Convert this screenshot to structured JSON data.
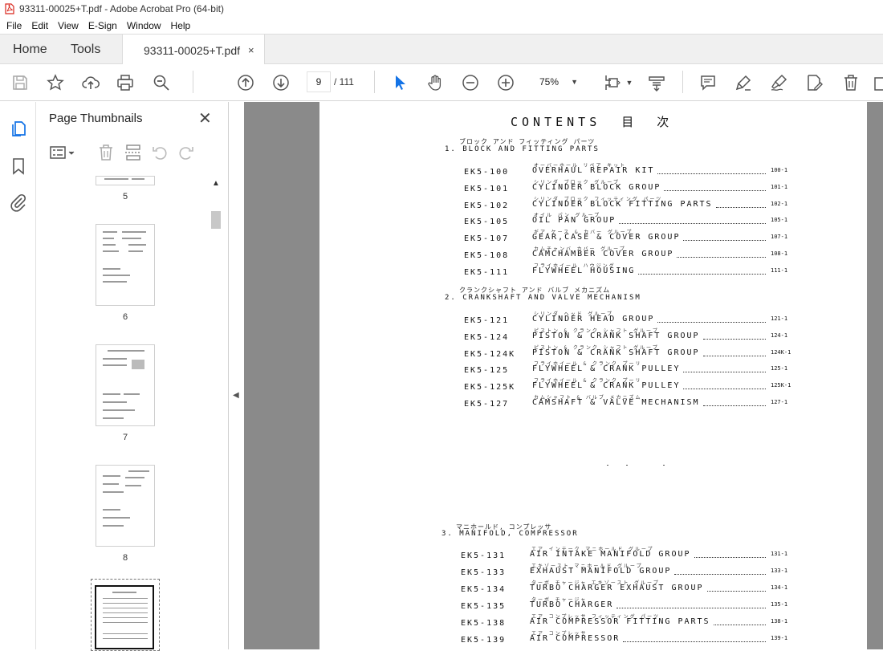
{
  "window": {
    "title": "93311-00025+T.pdf - Adobe Acrobat Pro (64-bit)"
  },
  "menu": [
    "File",
    "Edit",
    "View",
    "E-Sign",
    "Window",
    "Help"
  ],
  "tabs": {
    "home": "Home",
    "tools": "Tools",
    "document": "93311-00025+T.pdf",
    "close_glyph": "×"
  },
  "toolbar": {
    "current_page": "9",
    "total_pages": "/  111",
    "zoom": "75%",
    "icons": [
      "save-icon",
      "star-icon",
      "upload-icon",
      "print-icon",
      "zoom-search-icon",
      "prev-page-icon",
      "next-page-icon",
      "select-cursor-icon",
      "hand-icon",
      "zoom-out-icon",
      "zoom-in-icon",
      "fit-page-icon",
      "scroll-mode-icon",
      "comment-icon",
      "highlight-icon",
      "sign-icon",
      "edit-pdf-icon",
      "delete-icon",
      "more-icon"
    ],
    "accent": "#1473e6"
  },
  "thumbnails": {
    "header": "Page Thumbnails",
    "close_glyph": "✕",
    "page_numbers": [
      "5",
      "6",
      "7",
      "8"
    ]
  },
  "document": {
    "title": "CONTENTS",
    "title_jp": "目 次",
    "sections": [
      {
        "kana": "ブロック  アンド  フィッティング  パーツ",
        "heading": "1. BLOCK  AND  FITTING  PARTS",
        "entries": [
          {
            "code": "EK5-100",
            "kana": "オーバーホール  リペア  キット",
            "name": "OVERHAUL  REPAIR  KIT",
            "page": "100-1"
          },
          {
            "code": "EK5-101",
            "kana": "シリンダ  ブロック  グループ",
            "name": "CYLINDER  BLOCK  GROUP",
            "page": "101-1"
          },
          {
            "code": "EK5-102",
            "kana": "シリンダ  ブロック  フィッティング  パーツ",
            "name": "CYLINDER  BLOCK  FITTING  PARTS",
            "page": "102-1"
          },
          {
            "code": "EK5-105",
            "kana": "オイル  パン  グループ",
            "name": "OIL  PAN  GROUP",
            "page": "105-1"
          },
          {
            "code": "EK5-107",
            "kana": "ギア,ケース  &  カバー  グループ",
            "name": "GEAR,CASE  &  COVER  GROUP",
            "page": "107-1"
          },
          {
            "code": "EK5-108",
            "kana": "カムチャンバ  カバー  グループ",
            "name": "CAMCHAMBER  COVER  GROUP",
            "page": "108-1"
          },
          {
            "code": "EK5-111",
            "kana": "フライホイール  ハウジング",
            "name": "FLYWHEEL  HOUSING",
            "page": "111-1"
          }
        ]
      },
      {
        "kana": "クランクシャフト  アンド  バルブ  メカニズム",
        "heading": "2. CRANKSHAFT  AND  VALVE  MECHANISM",
        "entries": [
          {
            "code": "EK5-121",
            "kana": "シリンダ  ヘッド  グループ",
            "name": "CYLINDER  HEAD  GROUP",
            "page": "121-1"
          },
          {
            "code": "EK5-124",
            "kana": "ピストン  &  クランク  シャフト  グループ",
            "name": "PISTON  &  CRANK  SHAFT  GROUP",
            "page": "124-1"
          },
          {
            "code": "EK5-124K",
            "kana": "ピストン  &  クランク  シャフト  グループ",
            "name": "PISTON  &  CRANK  SHAFT  GROUP",
            "page": "124K-1"
          },
          {
            "code": "EK5-125",
            "kana": "フライホイール  &  クランク  プーリ",
            "name": "FLYWHEEL  &  CRANK  PULLEY",
            "page": "125-1"
          },
          {
            "code": "EK5-125K",
            "kana": "フライホイール  &  クランク  プーリ",
            "name": "FLYWHEEL  &  CRANK  PULLEY",
            "page": "125K-1"
          },
          {
            "code": "EK5-127",
            "kana": "カムシャフト  &  バルブ  メカニズム",
            "name": "CAMSHAFT  &  VALVE  MECHANISM",
            "page": "127-1"
          }
        ]
      },
      {
        "kana": "マニホールド, コンプレッサ",
        "heading": "3. MANIFOLD, COMPRESSOR",
        "entries": [
          {
            "code": "EK5-131",
            "kana": "エア  インテーク  マニホールド  グループ",
            "name": "AIR  INTAKE  MANIFOLD  GROUP",
            "page": "131-1"
          },
          {
            "code": "EK5-133",
            "kana": "エキゾースト  マニホールド  グループ",
            "name": "EXHAUST  MANIFOLD  GROUP",
            "page": "133-1"
          },
          {
            "code": "EK5-134",
            "kana": "ターボ  チャージャ  エキゾースト  グループ",
            "name": "TURBO  CHARGER  EXHAUST  GROUP",
            "page": "134-1"
          },
          {
            "code": "EK5-135",
            "kana": "ターボ  チャージャ",
            "name": "TURBO  CHARGER",
            "page": "135-1"
          },
          {
            "code": "EK5-138",
            "kana": "エア  コンプレッサ  フィッティング  パーツ",
            "name": "AIR  COMPRESSOR  FITTING  PARTS",
            "page": "138-1"
          },
          {
            "code": "EK5-139",
            "kana": "エア  コンプレッサ",
            "name": "AIR  COMPRESSOR",
            "page": "139-1"
          }
        ]
      }
    ]
  }
}
